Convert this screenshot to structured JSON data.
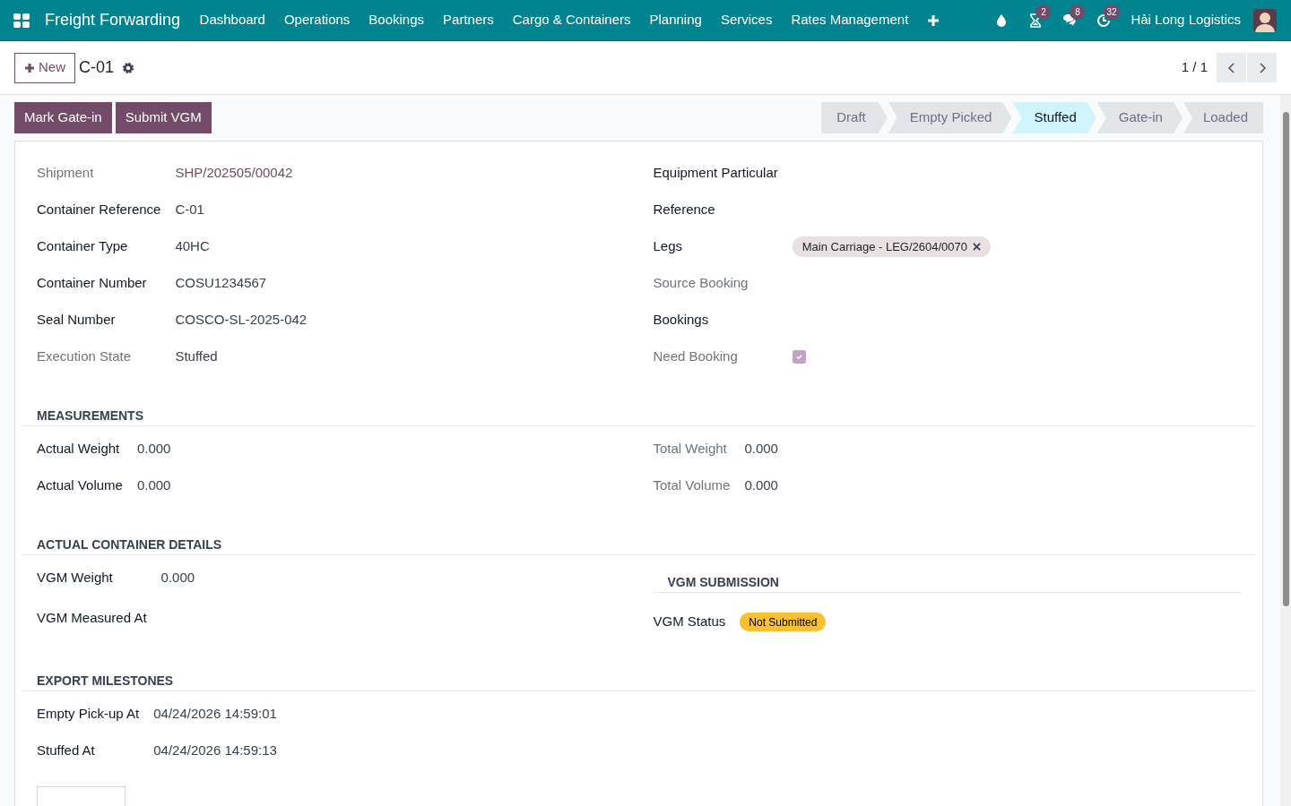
{
  "navbar": {
    "app_title": "Freight Forwarding",
    "menu": [
      "Dashboard",
      "Operations",
      "Bookings",
      "Partners",
      "Cargo & Containers",
      "Planning",
      "Services",
      "Rates Management"
    ],
    "systray": [
      {
        "kind": "droplet"
      },
      {
        "kind": "hourglass",
        "badge": "2"
      },
      {
        "kind": "chat",
        "badge": "8"
      },
      {
        "kind": "clock",
        "badge": "32"
      }
    ],
    "company": "Hải Long Logistics"
  },
  "control_panel": {
    "new_button": "New",
    "record_title": "C-01",
    "pager": "1 / 1"
  },
  "action_buttons": [
    "Mark Gate-in",
    "Submit VGM"
  ],
  "stages": [
    {
      "label": "Draft",
      "selected": false
    },
    {
      "label": "Empty Picked",
      "selected": false
    },
    {
      "label": "Stuffed",
      "selected": true
    },
    {
      "label": "Gate-in",
      "selected": false
    },
    {
      "label": "Loaded",
      "selected": false
    }
  ],
  "main": {
    "left": [
      {
        "label": "Shipment",
        "muted": true,
        "kind": "link",
        "value": "SHP/202505/00042"
      },
      {
        "label": "Container Reference",
        "muted": false,
        "kind": "text",
        "value": "C-01"
      },
      {
        "label": "Container Type",
        "muted": false,
        "kind": "text",
        "value": "40HC"
      },
      {
        "label": "Container Number",
        "muted": false,
        "kind": "text",
        "value": "COSU1234567"
      },
      {
        "label": "Seal Number",
        "muted": false,
        "kind": "text",
        "value": "COSCO-SL-2025-042"
      },
      {
        "label": "Execution State",
        "muted": true,
        "kind": "text",
        "value": "Stuffed"
      }
    ],
    "right": [
      {
        "label": "Equipment Particular",
        "muted": false
      },
      {
        "label": "Reference",
        "muted": false
      },
      {
        "label": "Legs",
        "muted": false,
        "kind": "tag",
        "value": "Main Carriage - LEG/2604/0070"
      },
      {
        "label": "Source Booking",
        "muted": true
      },
      {
        "label": "Bookings",
        "muted": false
      },
      {
        "label": "Need Booking",
        "muted": true,
        "kind": "checkbox",
        "checked": true
      }
    ]
  },
  "sections": [
    {
      "title": "MEASUREMENTS",
      "left": [
        {
          "label": "Actual Weight",
          "muted": false,
          "kind": "text",
          "value": "0.000"
        },
        {
          "label": "Actual Volume",
          "muted": false,
          "kind": "text",
          "value": "0.000"
        }
      ],
      "right": [
        {
          "label": "Total Weight",
          "muted": true,
          "kind": "text",
          "value": "0.000"
        },
        {
          "label": "Total Volume",
          "muted": true,
          "kind": "text",
          "value": "0.000"
        }
      ]
    },
    {
      "title": "ACTUAL CONTAINER DETAILS",
      "left": [
        {
          "label": "VGM Weight",
          "muted": false,
          "kind": "text",
          "value": "0.000"
        },
        {
          "label": "VGM Measured At",
          "muted": false
        }
      ],
      "right_subsection": {
        "title": "VGM SUBMISSION",
        "fields": [
          {
            "label": "VGM Status",
            "muted": false,
            "kind": "badge",
            "value": "Not Submitted",
            "color": "#fbc02d"
          }
        ]
      }
    },
    {
      "title": "EXPORT MILESTONES",
      "left": [
        {
          "label": "Empty Pick-up At",
          "muted": false,
          "kind": "text",
          "value": "04/24/2026 14:59:01"
        },
        {
          "label": "Stuffed At",
          "muted": false,
          "kind": "text",
          "value": "04/24/2026 14:59:13"
        }
      ]
    }
  ]
}
